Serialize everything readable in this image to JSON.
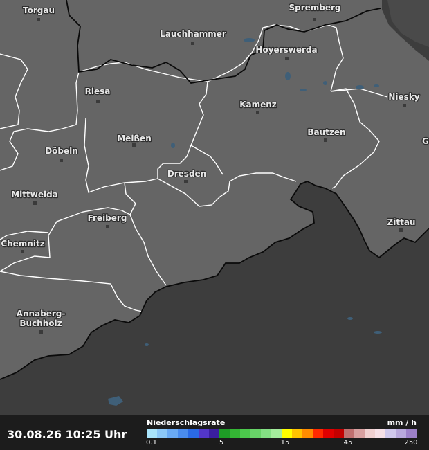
{
  "map": {
    "cities": [
      {
        "name": "Torgau"
      },
      {
        "name": "Spremberg"
      },
      {
        "name": "Lauchhammer"
      },
      {
        "name": "Hoyerswerda"
      },
      {
        "name": "Riesa"
      },
      {
        "name": "Kamenz"
      },
      {
        "name": "Niesky"
      },
      {
        "name": "Meißen"
      },
      {
        "name": "Bautzen"
      },
      {
        "name": "Döbeln"
      },
      {
        "name": "Dresden"
      },
      {
        "name": "Mittweida"
      },
      {
        "name": "Freiberg"
      },
      {
        "name": "Zittau"
      },
      {
        "name": "Chemnitz"
      },
      {
        "name": "Annaberg-"
      },
      {
        "name": "Buchholz"
      },
      {
        "name": "G"
      }
    ],
    "colors": {
      "land": "#656565",
      "outside": "#3d3d3d",
      "border": "#ffffff",
      "state_border": "#111111",
      "water": "#3f5f78"
    }
  },
  "footer": {
    "timestamp": "30.08.26 10:25 Uhr",
    "legend_title": "Niederschlagsrate",
    "legend_unit": "mm / h",
    "ticks": [
      "0.1",
      "5",
      "15",
      "45",
      "250"
    ],
    "colors": [
      "#a9e4fb",
      "#8cc8f8",
      "#6aaaf4",
      "#4a8cee",
      "#2a6ae6",
      "#5236c8",
      "#3a1ea0",
      "#1e9c26",
      "#34b634",
      "#4cc84c",
      "#68d468",
      "#84e084",
      "#a4ec9c",
      "#ffff00",
      "#ffc400",
      "#ff8c00",
      "#ff2a00",
      "#e00000",
      "#c40000",
      "#c07070",
      "#d8a0a0",
      "#f0d0d0",
      "#f6e0e6",
      "#d0c8ec",
      "#b8a8dc",
      "#9c80c8"
    ]
  }
}
